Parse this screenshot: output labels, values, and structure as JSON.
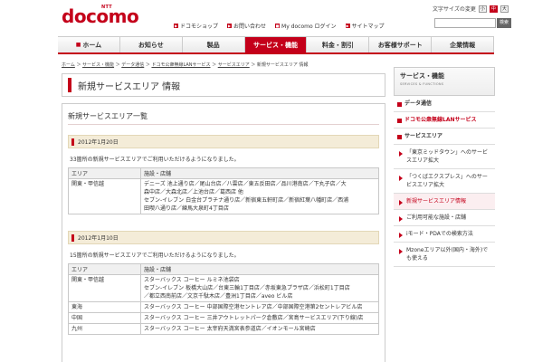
{
  "header": {
    "logo_ntt": "NTT",
    "logo": "docomo",
    "text_size_label": "文字サイズの変更",
    "text_size_small": "小",
    "text_size_medium": "中",
    "text_size_large": "大",
    "util_links": [
      "ドコモショップ",
      "お問い合わせ",
      "My docomo ログイン",
      "サイトマップ"
    ],
    "search_button": "検索"
  },
  "nav": {
    "items": [
      "ホーム",
      "お知らせ",
      "製品",
      "サービス・機能",
      "料金・割引",
      "お客様サポート",
      "企業情報"
    ],
    "active_index": 3
  },
  "breadcrumb": [
    "ホーム",
    "サービス・機能",
    "データ通信",
    "ドコモ公衆無線LANサービス",
    "サービスエリア",
    "新規サービスエリア 情報"
  ],
  "main": {
    "title": "新規サービスエリア 情報",
    "section_title": "新規サービスエリア一覧",
    "blocks": [
      {
        "date": "2012年1月20日",
        "desc": "33箇所の新規サービスエリアでご利用いただけるようになりました。",
        "col_area": "エリア",
        "col_shop": "施設・店舗",
        "rows": [
          {
            "area": "関東・甲信越",
            "shops": [
              "デニーズ 池上通り店／尾山台店／八雲店／東五反田店／品川港南店／下丸子店／大",
              "森中店／大森北店／上池台店／葛西店 他",
              "セブン-イレブン 白金台プラチナ通り店／新宿東五軒町店／新宿紅葉八幡町店／西浦",
              "田喫八通り店／練馬大泉町4丁目店"
            ]
          }
        ]
      },
      {
        "date": "2012年1月10日",
        "desc": "15箇所の新規サービスエリアでご利用いただけるようになりました。",
        "col_area": "エリア",
        "col_shop": "施設・店舗",
        "rows": [
          {
            "area": "関東・甲信越",
            "shops": [
              "スターバックス コーヒー ルミネ池袋店",
              "セブン-イレブン 板橋大山店／台東三輪1丁目店／赤坂東急プラザ店／浜松町1丁目店",
              "／都立西南前店／文京千駄木店／豊洲1丁目店／aveo ビル店"
            ]
          },
          {
            "area": "東海",
            "shops": [
              "スターバックス コーヒー 中部国際空港セントレア店／中部国際空港第2セントレアビル店"
            ]
          },
          {
            "area": "中国",
            "shops": [
              "スターバックス コーヒー 三井アウトレットパーク倉敷店／宮島サービスエリア(下り線)店"
            ]
          },
          {
            "area": "九州",
            "shops": [
              "スターバックス コーヒー 太宰府天満宮表参道店／イオンモール宮崎店"
            ]
          }
        ]
      }
    ]
  },
  "sidebar": {
    "head_jp": "サービス・機能",
    "head_en": "SERVICES & FUNCTIONS",
    "items": [
      {
        "label": "データ通信",
        "kind": "cat"
      },
      {
        "label": "ドコモ公衆無線LANサービス",
        "kind": "cat-red"
      },
      {
        "label": "サービスエリア",
        "kind": "cat"
      },
      {
        "label": "「東京ミッドタウン」へのサービスエリア拡大",
        "kind": "sub"
      },
      {
        "label": "「つくばエクスプレス」へのサービスエリア拡大",
        "kind": "sub"
      },
      {
        "label": "新規サービスエリア情報",
        "kind": "sub current"
      },
      {
        "label": "ご利用可能な施設・店舗",
        "kind": "sub"
      },
      {
        "label": "iモード・PDAでの検索方法",
        "kind": "sub"
      },
      {
        "label": "Mzoneエリア以外(国内・海外)でも使える",
        "kind": "sub"
      }
    ]
  }
}
